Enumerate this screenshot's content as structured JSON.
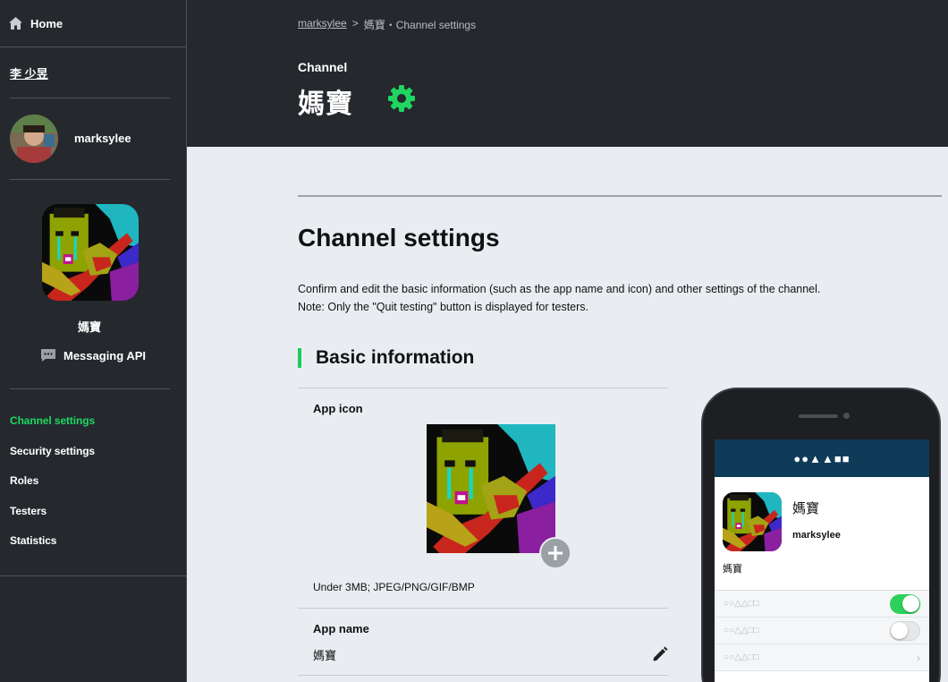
{
  "sidebar": {
    "home_label": "Home",
    "account_name": "李 少昱",
    "username": "marksylee",
    "channel_name": "媽寶",
    "api_label": "Messaging API",
    "nav": [
      {
        "label": "Channel settings",
        "active": true
      },
      {
        "label": "Security settings",
        "active": false
      },
      {
        "label": "Roles",
        "active": false
      },
      {
        "label": "Testers",
        "active": false
      },
      {
        "label": "Statistics",
        "active": false
      }
    ]
  },
  "header": {
    "breadcrumb_link": "marksylee",
    "breadcrumb_sep": ">",
    "breadcrumb_current": "媽寶・Channel settings",
    "subtitle": "Channel",
    "title": "媽寶"
  },
  "main": {
    "page_title": "Channel settings",
    "description_line1": "Confirm and edit the basic information (such as the app name and icon) and other settings of the channel.",
    "description_line2": "Note: Only the \"Quit testing\" button is displayed for testers.",
    "section_title": "Basic information",
    "app_icon_label": "App icon",
    "app_icon_note": "Under 3MB; JPEG/PNG/GIF/BMP",
    "app_name_label": "App name",
    "app_name_value": "媽寶"
  },
  "preview": {
    "top_bar": "●●▲▲■■",
    "name": "媽寶",
    "username": "marksylee",
    "description": "媽寶",
    "rows": [
      {
        "label": "○○△△□□",
        "control": "toggle",
        "on": true
      },
      {
        "label": "○○△△□□",
        "control": "toggle",
        "on": false
      },
      {
        "label": "○○△△□□",
        "control": "chevron",
        "chevron": "›"
      }
    ]
  },
  "colors": {
    "accent": "#1fd760",
    "dark": "#25292e",
    "background": "#e9edf1",
    "preview_header": "#0e3b58"
  },
  "icons": [
    "home-icon",
    "gear-icon",
    "chat-icon",
    "plus-icon",
    "pencil-icon"
  ]
}
